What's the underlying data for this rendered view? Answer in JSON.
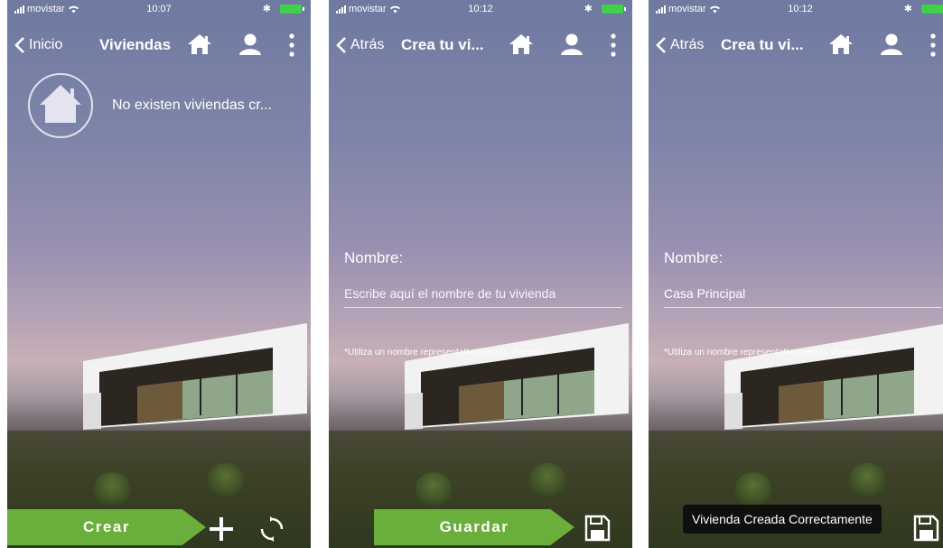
{
  "screens": [
    {
      "status": {
        "carrier": "movistar",
        "time": "10:07"
      },
      "nav": {
        "back_label": "Inicio",
        "title": "Viviendas"
      },
      "empty_message": "No existen viviendas cr...",
      "action_label": "Crear"
    },
    {
      "status": {
        "carrier": "movistar",
        "time": "10:12"
      },
      "nav": {
        "back_label": "Atrás",
        "title": "Crea tu vi..."
      },
      "form": {
        "name_label": "Nombre:",
        "name_placeholder": "Escribe aquí el nombre de tu vivienda",
        "name_value": "",
        "hint": "*Utiliza un nombre representativo para tu vivienda"
      },
      "action_label": "Guardar"
    },
    {
      "status": {
        "carrier": "movistar",
        "time": "10:12"
      },
      "nav": {
        "back_label": "Atrás",
        "title": "Crea tu vi..."
      },
      "form": {
        "name_label": "Nombre:",
        "name_value": "Casa Principal",
        "hint": "*Utiliza un nombre representativo para tu vivienda"
      },
      "toast": "Vivienda Creada Correctamente"
    }
  ],
  "colors": {
    "accent_green": "#6aae3c",
    "battery_green": "#3fd14b",
    "toast_bg": "#0c0c0c"
  },
  "icons": [
    "signal-icon",
    "wifi-icon",
    "bluetooth-icon",
    "battery-icon",
    "back-chevron-icon",
    "home-icon",
    "user-icon",
    "more-vertical-icon",
    "house-circle-icon",
    "plus-icon",
    "refresh-icon",
    "save-icon"
  ]
}
